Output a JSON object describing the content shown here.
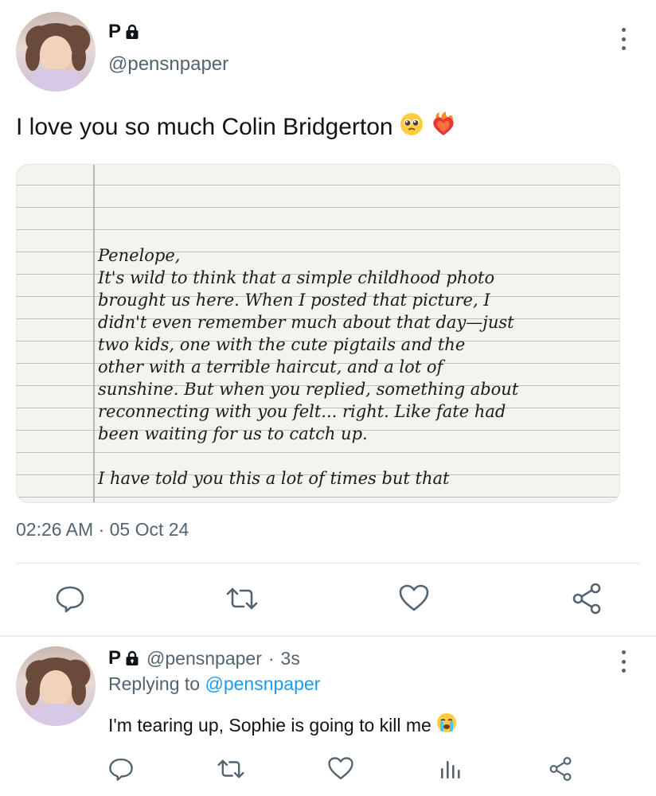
{
  "tweet": {
    "display_name": "P",
    "handle": "@pensnpaper",
    "text": "I love you so much Colin Bridgerton",
    "emojis": [
      "pleading-face-emoji",
      "heart-on-fire-emoji"
    ],
    "image_text": "Penelope,\nIt's wild to think that a simple childhood photo\nbrought us here. When I posted that picture, I\ndidn't even remember much about that day—just\ntwo kids, one with the cute pigtails and the\nother with a terrible haircut, and a lot of\nsunshine. But when you replied, something about\nreconnecting with you felt... right. Like fate had\nbeen waiting for us to catch up.\n\nI have told you this a lot of times but that",
    "timestamp": "02:26 AM · 05 Oct 24",
    "actions": [
      "reply-icon",
      "retweet-icon",
      "like-icon",
      "share-icon"
    ]
  },
  "reply": {
    "display_name": "P",
    "handle": "@pensnpaper",
    "separator": "·",
    "time": "3s",
    "replying_label": "Replying to",
    "replying_to": "@pensnpaper",
    "text": "I'm tearing up, Sophie is going to kill me",
    "emoji": "loudly-crying-face-emoji",
    "actions": [
      "reply-icon",
      "retweet-icon",
      "like-icon",
      "views-icon",
      "share-icon"
    ]
  },
  "colors": {
    "text_primary": "#0f1419",
    "text_secondary": "#536471",
    "accent": "#1d9bf0",
    "divider": "#e3e6ea"
  }
}
